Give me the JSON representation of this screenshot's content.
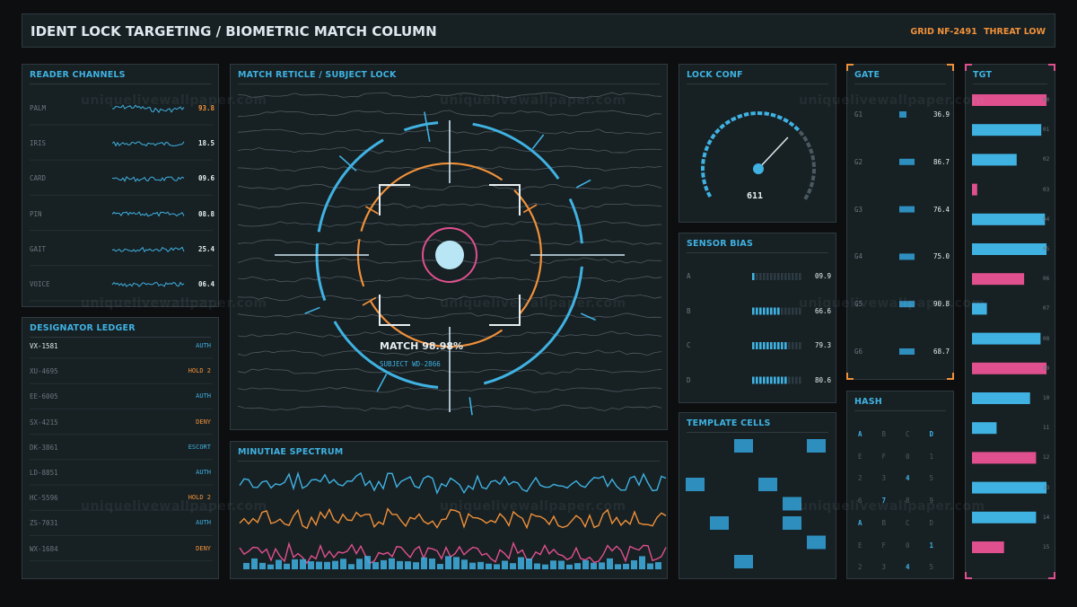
{
  "header": {
    "title": "IDENT LOCK TARGETING / BIOMETRIC MATCH COLUMN",
    "grid": "GRID NF-2491",
    "threat": "THREAT LOW"
  },
  "reader_channels": {
    "title": "READER CHANNELS",
    "rows": [
      {
        "label": "PALM",
        "value": "93.8",
        "color": "#f0913a"
      },
      {
        "label": "IRIS",
        "value": "18.5",
        "color": "#e6eef2"
      },
      {
        "label": "CARD",
        "value": "09.6",
        "color": "#e6eef2"
      },
      {
        "label": "PIN",
        "value": "08.8",
        "color": "#e6eef2"
      },
      {
        "label": "GAIT",
        "value": "25.4",
        "color": "#e6eef2"
      },
      {
        "label": "VOICE",
        "value": "06.4",
        "color": "#e6eef2"
      }
    ]
  },
  "ledger": {
    "title": "DESIGNATOR LEDGER",
    "rows": [
      {
        "id": "VX-1581",
        "status": "AUTH",
        "status_color": "#3fb2e2",
        "id_color": "#e6eef2"
      },
      {
        "id": "XU-4695",
        "status": "HOLD 2",
        "status_color": "#f0913a",
        "id_color": "#6b7780"
      },
      {
        "id": "EE-6005",
        "status": "AUTH",
        "status_color": "#3fb2e2",
        "id_color": "#6b7780"
      },
      {
        "id": "SX-4215",
        "status": "DENY",
        "status_color": "#f0913a",
        "id_color": "#6b7780"
      },
      {
        "id": "DK-3861",
        "status": "ESCORT",
        "status_color": "#3fb2e2",
        "id_color": "#6b7780"
      },
      {
        "id": "LD-8851",
        "status": "AUTH",
        "status_color": "#3fb2e2",
        "id_color": "#6b7780"
      },
      {
        "id": "HC-5596",
        "status": "HOLD 2",
        "status_color": "#f0913a",
        "id_color": "#6b7780"
      },
      {
        "id": "ZS-7031",
        "status": "AUTH",
        "status_color": "#3fb2e2",
        "id_color": "#6b7780"
      },
      {
        "id": "WX-1684",
        "status": "DENY",
        "status_color": "#f0913a",
        "id_color": "#6b7780"
      }
    ]
  },
  "reticle": {
    "title": "MATCH RETICLE / SUBJECT LOCK",
    "match": "MATCH 98.98%",
    "subject": "SUBJECT WD-2866"
  },
  "spectrum": {
    "title": "MINUTIAE SPECTRUM"
  },
  "lock_conf": {
    "title": "LOCK CONF",
    "value": "611",
    "needle_fraction": 0.68
  },
  "sensor_bias": {
    "title": "SENSOR BIAS",
    "rows": [
      {
        "label": "A",
        "value": "09.9",
        "lit": 1
      },
      {
        "label": "B",
        "value": "66.6",
        "lit": 8
      },
      {
        "label": "C",
        "value": "79.3",
        "lit": 10
      },
      {
        "label": "D",
        "value": "80.6",
        "lit": 10
      }
    ]
  },
  "template_cells": {
    "title": "TEMPLATE CELLS",
    "cells": [
      [
        2,
        0
      ],
      [
        5,
        0
      ],
      [
        0,
        2
      ],
      [
        3,
        2
      ],
      [
        4,
        3
      ],
      [
        1,
        4
      ],
      [
        4,
        4
      ],
      [
        5,
        5
      ],
      [
        2,
        6
      ]
    ]
  },
  "gate": {
    "title": "GATE",
    "rows": [
      {
        "label": "G1",
        "value": "36.9"
      },
      {
        "label": "G2",
        "value": "86.7"
      },
      {
        "label": "G3",
        "value": "76.4"
      },
      {
        "label": "G4",
        "value": "75.0"
      },
      {
        "label": "G5",
        "value": "90.8"
      },
      {
        "label": "G6",
        "value": "68.7"
      }
    ]
  },
  "hash": {
    "title": "HASH",
    "rows": [
      [
        "A",
        "B",
        "C",
        "D"
      ],
      [
        "E",
        "F",
        "0",
        "1"
      ],
      [
        "2",
        "3",
        "4",
        "5"
      ],
      [
        "6",
        "7",
        "8",
        "9"
      ],
      [
        "A",
        "B",
        "C",
        "D"
      ],
      [
        "E",
        "F",
        "0",
        "1"
      ],
      [
        "2",
        "3",
        "4",
        "5"
      ]
    ],
    "bright": [
      [
        0,
        0
      ],
      [
        0,
        3
      ],
      [
        2,
        2
      ],
      [
        3,
        1
      ],
      [
        4,
        0
      ],
      [
        5,
        3
      ],
      [
        6,
        2
      ]
    ]
  },
  "tgt": {
    "title": "TGT",
    "rows": [
      {
        "label": "00",
        "fraction": 1.0,
        "color": "#e0508e"
      },
      {
        "label": "01",
        "fraction": 0.93,
        "color": "#3fb2e2"
      },
      {
        "label": "02",
        "fraction": 0.6,
        "color": "#3fb2e2"
      },
      {
        "label": "03",
        "fraction": 0.07,
        "color": "#e0508e"
      },
      {
        "label": "04",
        "fraction": 0.98,
        "color": "#3fb2e2"
      },
      {
        "label": "05",
        "fraction": 1.0,
        "color": "#3fb2e2"
      },
      {
        "label": "06",
        "fraction": 0.7,
        "color": "#e0508e"
      },
      {
        "label": "07",
        "fraction": 0.2,
        "color": "#3fb2e2"
      },
      {
        "label": "08",
        "fraction": 0.92,
        "color": "#3fb2e2"
      },
      {
        "label": "09",
        "fraction": 1.0,
        "color": "#e0508e"
      },
      {
        "label": "10",
        "fraction": 0.78,
        "color": "#3fb2e2"
      },
      {
        "label": "11",
        "fraction": 0.33,
        "color": "#3fb2e2"
      },
      {
        "label": "12",
        "fraction": 0.86,
        "color": "#e0508e"
      },
      {
        "label": "13",
        "fraction": 1.0,
        "color": "#3fb2e2"
      },
      {
        "label": "14",
        "fraction": 0.86,
        "color": "#3fb2e2"
      },
      {
        "label": "15",
        "fraction": 0.43,
        "color": "#e0508e"
      }
    ]
  },
  "watermark": "uniquelivewallpaper.com",
  "colors": {
    "blue": "#3fb2e2",
    "orange": "#f0913a",
    "pink": "#e0508e",
    "light": "#e6eef2"
  }
}
